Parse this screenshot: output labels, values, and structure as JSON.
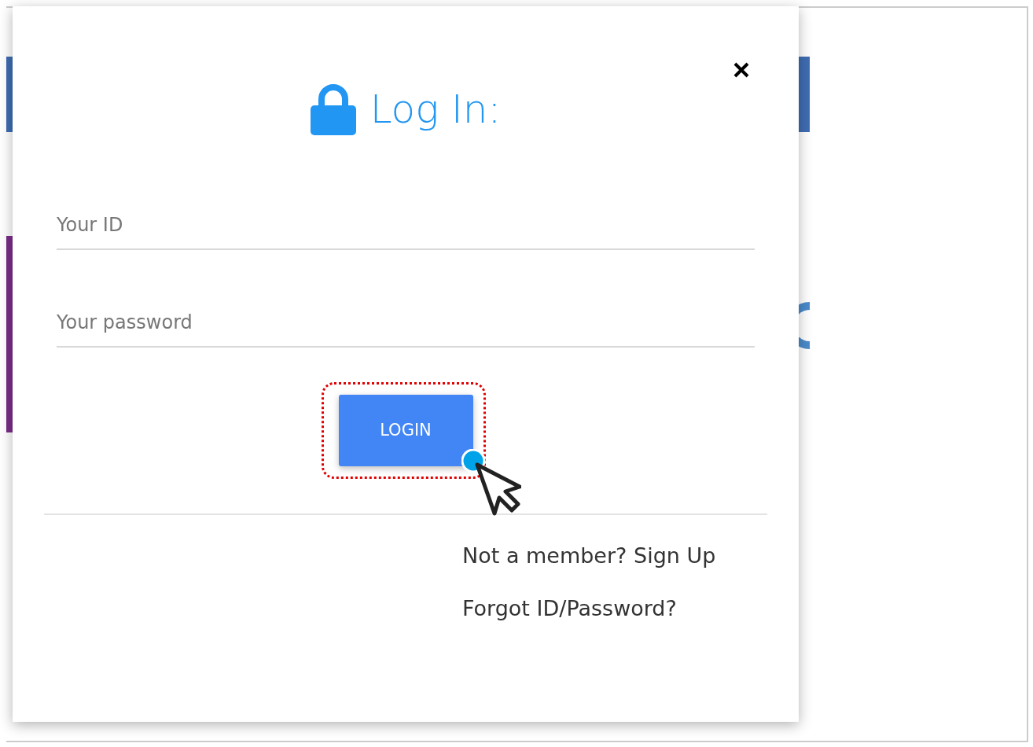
{
  "modal": {
    "title": "Log In:",
    "fields": [
      {
        "placeholder": "Your ID"
      },
      {
        "placeholder": "Your password"
      }
    ],
    "login_button": {
      "label": "LOGIN",
      "highlighted": true
    },
    "links": [
      "Not a member? Sign Up",
      "Forgot ID/Password?"
    ]
  }
}
